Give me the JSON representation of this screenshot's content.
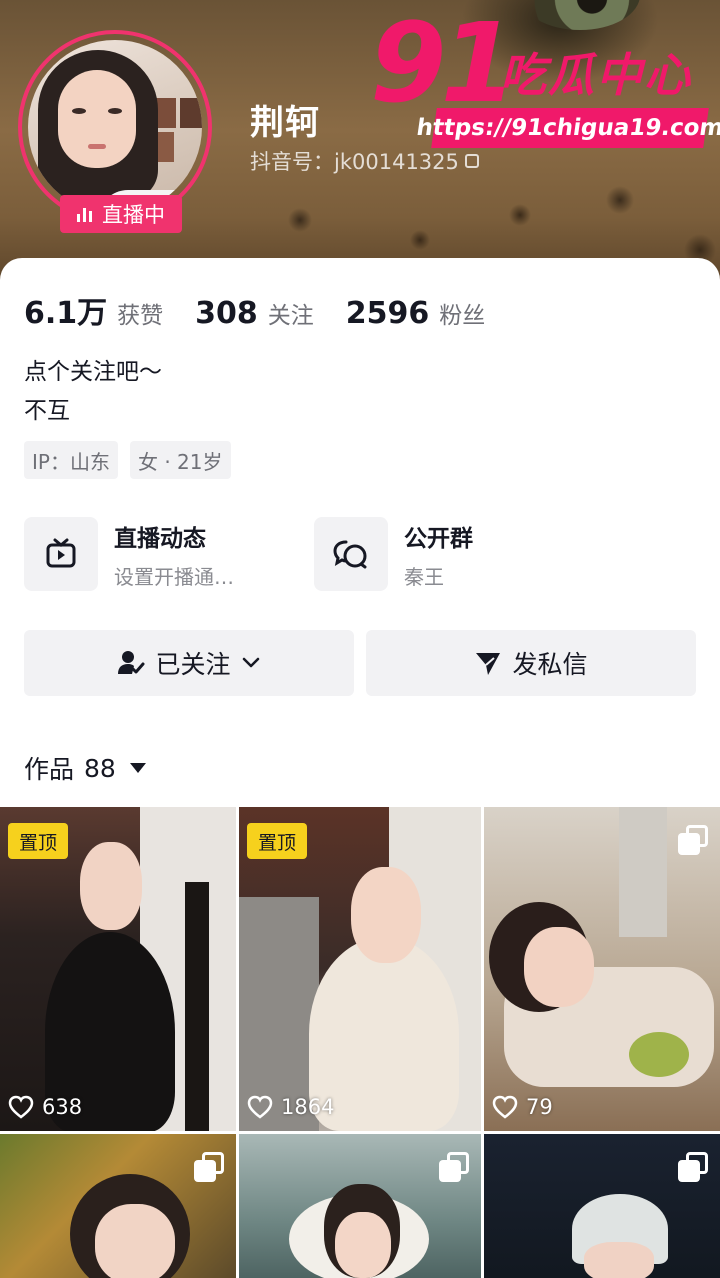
{
  "profile": {
    "nickname": "荆轲",
    "douyin_id": "抖音号：jk00141325",
    "live_badge": "直播中"
  },
  "watermark": {
    "number": "91",
    "title": "吃瓜中心",
    "url": "https://91chigua19.com"
  },
  "stats": [
    {
      "value": "6.1万",
      "label": "获赞"
    },
    {
      "value": "308",
      "label": "关注"
    },
    {
      "value": "2596",
      "label": "粉丝"
    }
  ],
  "bio": [
    "点个关注吧～",
    "不互"
  ],
  "tags": [
    "IP：山东",
    "女 · 21岁"
  ],
  "entries": [
    {
      "title": "直播动态",
      "subtitle": "设置开播通…",
      "icon": "tv-icon"
    },
    {
      "title": "公开群",
      "subtitle": "秦王",
      "icon": "chat-bubbles-icon"
    }
  ],
  "actions": {
    "followed_label": "已关注",
    "message_label": "发私信"
  },
  "works": {
    "label": "作品",
    "count": "88"
  },
  "videos": [
    {
      "pinned": true,
      "pin_label": "置顶",
      "likes": "638",
      "multi_image": false
    },
    {
      "pinned": true,
      "pin_label": "置顶",
      "likes": "1864",
      "multi_image": false
    },
    {
      "pinned": false,
      "likes": "79",
      "multi_image": true
    },
    {
      "pinned": false,
      "likes": "",
      "multi_image": true
    },
    {
      "pinned": false,
      "likes": "",
      "multi_image": true
    },
    {
      "pinned": false,
      "likes": "",
      "multi_image": true
    }
  ],
  "colors": {
    "accent_pink": "#f0336e",
    "watermark_pink": "#f0196a",
    "pin_yellow": "#f6d11d",
    "text_primary": "#161823",
    "text_secondary": "#6f7077",
    "chip_bg": "#f2f2f4"
  }
}
